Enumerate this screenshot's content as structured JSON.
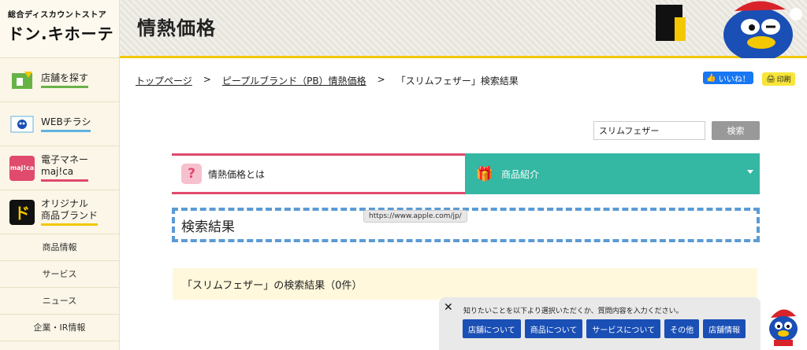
{
  "sidebar": {
    "logo_tagline": "総合ディスカウントストア",
    "logo_name": "ドン.キホーテ",
    "nav": [
      {
        "label": "店舗を探す",
        "color": "#67b346"
      },
      {
        "label": "WEBチラシ",
        "color": "#5fb3e0"
      },
      {
        "label": "電子マネー\nmaj!ca",
        "color": "#e04a6d"
      },
      {
        "label": "オリジナル\n商品ブランド",
        "color": "#f3c800"
      }
    ],
    "links": [
      "商品情報",
      "サービス",
      "ニュース",
      "企業・IR情報"
    ]
  },
  "header": {
    "title": "情熱価格"
  },
  "breadcrumb": {
    "home": "トップページ",
    "sep": ">",
    "pb": "ピープルブランド（PB）情熱価格",
    "current": "「スリムフェザー」検索結果"
  },
  "social": {
    "like": "いいね！",
    "print": "印刷"
  },
  "search": {
    "value": "スリムフェザー",
    "button": "検索"
  },
  "tabs": {
    "about": "情熱価格とは",
    "products": "商品紹介"
  },
  "tooltip": "https://www.apple.com/jp/",
  "results": {
    "heading": "検索結果",
    "count_text": "「スリムフェザー」の検索結果（0件）"
  },
  "chat": {
    "close": "✕",
    "message": "知りたいことを以下より選択いただくか、質問内容を入力ください。",
    "buttons": [
      "店舗について",
      "商品について",
      "サービスについて",
      "その他",
      "店舗情報"
    ]
  },
  "colors": {
    "accent_yellow": "#f3c800",
    "tab_pink": "#e04a6d",
    "tab_teal": "#34b7a3",
    "chat_blue": "#1a4fb5"
  }
}
